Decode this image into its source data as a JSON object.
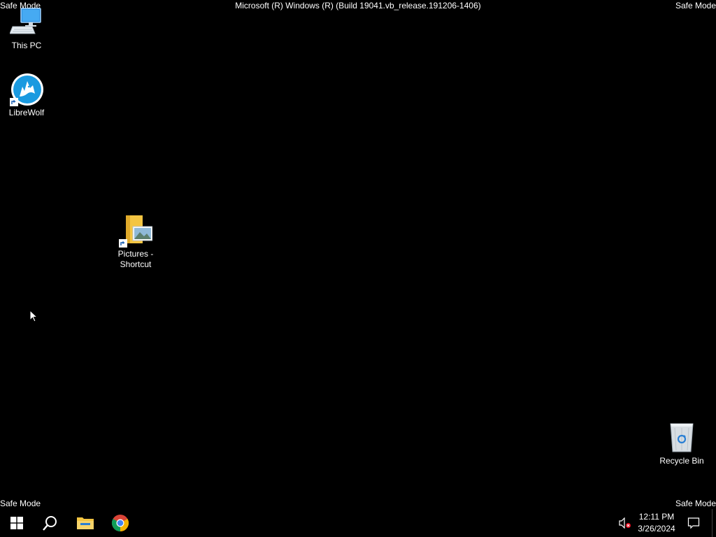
{
  "overlay": {
    "safe_mode_label": "Safe Mode",
    "build_string": "Microsoft (R) Windows (R) (Build 19041.vb_release.191206-1406)"
  },
  "desktop": {
    "icons": [
      {
        "label": "This PC",
        "icon": "this-pc-icon"
      },
      {
        "label": "LibreWolf",
        "icon": "librewolf-icon"
      },
      {
        "label": "Pictures - Shortcut",
        "icon": "pictures-folder-icon"
      },
      {
        "label": "Recycle Bin",
        "icon": "recycle-bin-icon"
      }
    ]
  },
  "taskbar": {
    "pinned": [
      {
        "name": "Start",
        "icon": "windows-logo-icon"
      },
      {
        "name": "Search",
        "icon": "search-icon"
      },
      {
        "name": "File Explorer",
        "icon": "file-explorer-icon"
      },
      {
        "name": "Google Chrome",
        "icon": "chrome-icon"
      }
    ],
    "tray": {
      "volume_icon": "volume-muted-icon",
      "time": "12:11 PM",
      "date": "3/26/2024",
      "notification_icon": "action-center-icon"
    }
  },
  "colors": {
    "background": "#000000",
    "text": "#ffffff",
    "accent_blue": "#1a9ae0",
    "folder_yellow": "#f4c542"
  }
}
